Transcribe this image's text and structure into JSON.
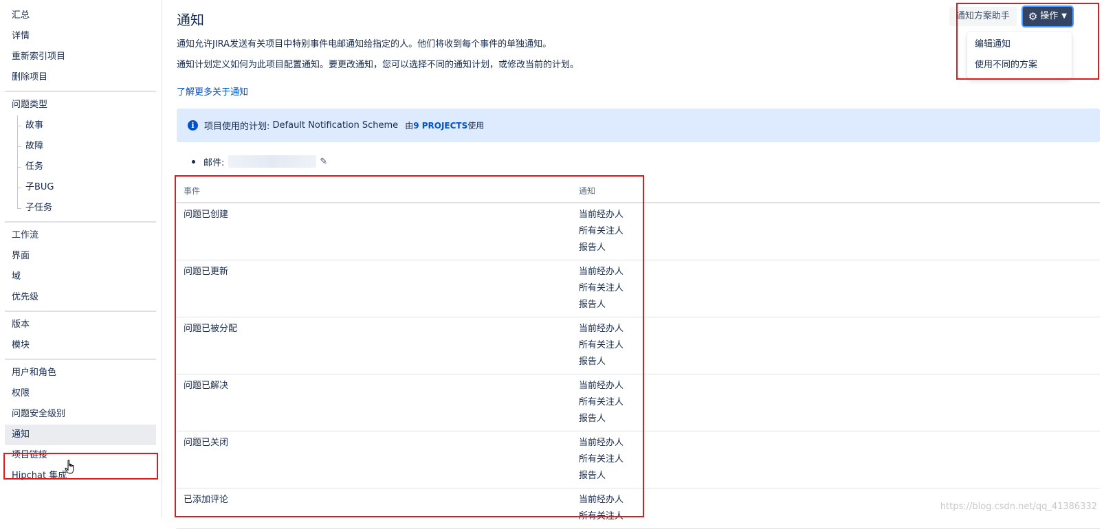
{
  "sidebar": {
    "groups": [
      {
        "items": [
          {
            "label": "汇总"
          },
          {
            "label": "详情"
          },
          {
            "label": "重新索引项目"
          },
          {
            "label": "删除项目"
          }
        ]
      },
      {
        "items": [
          {
            "label": "问题类型"
          },
          {
            "label": "故事"
          },
          {
            "label": "故障"
          },
          {
            "label": "任务"
          },
          {
            "label": "子BUG"
          },
          {
            "label": "子任务"
          }
        ]
      },
      {
        "items": [
          {
            "label": "工作流"
          },
          {
            "label": "界面"
          },
          {
            "label": "域"
          },
          {
            "label": "优先级"
          }
        ]
      },
      {
        "items": [
          {
            "label": "版本"
          },
          {
            "label": "模块"
          }
        ]
      },
      {
        "items": [
          {
            "label": "用户和角色"
          },
          {
            "label": "权限"
          },
          {
            "label": "问题安全级别"
          },
          {
            "label": "通知"
          },
          {
            "label": "项目链接"
          },
          {
            "label": "Hipchat 集成"
          }
        ]
      }
    ],
    "active_item": "通知"
  },
  "header": {
    "title": "通知",
    "desc1": "通知允许JIRA发送有关项目中特别事件电邮通知给指定的人。他们将收到每个事件的单独通知。",
    "desc2": "通知计划定义如何为此项目配置通知。要更改通知，您可以选择不同的通知计划，或修改当前的计划。",
    "learn_more": "了解更多关于通知"
  },
  "actions": {
    "helper_label": "通知方案助手",
    "ops_label": "操作",
    "dropdown": [
      "编辑通知",
      "使用不同的方案"
    ]
  },
  "info": {
    "label": "项目使用的计划:",
    "scheme": "Default Notification Scheme",
    "used_prefix": "由",
    "projects": "9 PROJECTS",
    "used_suffix": "使用"
  },
  "email": {
    "label": "邮件:",
    "value": ""
  },
  "table": {
    "headers": {
      "event": "事件",
      "notification": "通知"
    },
    "rows": [
      {
        "event": "问题已创建",
        "recipients": [
          "当前经办人",
          "所有关注人",
          "报告人"
        ]
      },
      {
        "event": "问题已更新",
        "recipients": [
          "当前经办人",
          "所有关注人",
          "报告人"
        ]
      },
      {
        "event": "问题已被分配",
        "recipients": [
          "当前经办人",
          "所有关注人",
          "报告人"
        ]
      },
      {
        "event": "问题已解决",
        "recipients": [
          "当前经办人",
          "所有关注人",
          "报告人"
        ]
      },
      {
        "event": "问题已关闭",
        "recipients": [
          "当前经办人",
          "所有关注人",
          "报告人"
        ]
      },
      {
        "event": "已添加评论",
        "recipients": [
          "当前经办人",
          "所有关注人"
        ]
      }
    ]
  },
  "watermark": "https://blog.csdn.net/qq_41386332",
  "colors": {
    "highlight": "#e01a1a",
    "link": "#0052cc",
    "info_bg": "#deebff",
    "ops_bg": "#344563"
  }
}
